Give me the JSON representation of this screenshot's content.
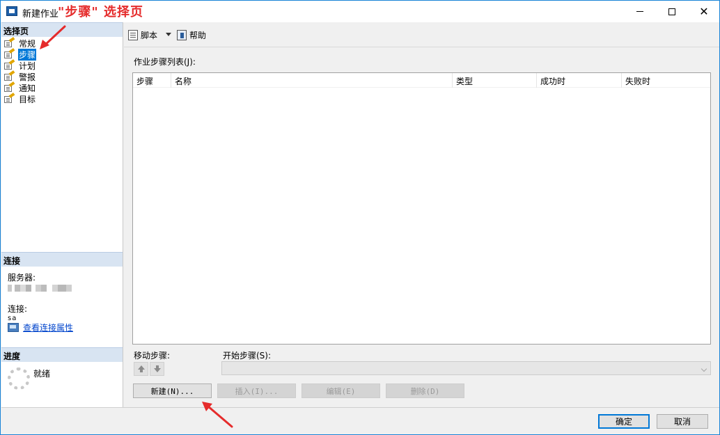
{
  "window": {
    "title": "新建作业",
    "annotation": "\"步骤\" 选择页",
    "minimize_label": "minimize",
    "maximize_label": "maximize",
    "close_glyph": "✕"
  },
  "left_panel": {
    "pages_header": "选择页",
    "pages": [
      {
        "label": "常规",
        "selected": false
      },
      {
        "label": "步骤",
        "selected": true
      },
      {
        "label": "计划",
        "selected": false
      },
      {
        "label": "警报",
        "selected": false
      },
      {
        "label": "通知",
        "selected": false
      },
      {
        "label": "目标",
        "selected": false
      }
    ],
    "connection_header": "连接",
    "server_label": "服务器:",
    "connection_label": "连接:",
    "connection_user": "sa",
    "view_properties_link": "查看连接属性",
    "progress_header": "进度",
    "progress_status": "就绪"
  },
  "toolbar": {
    "script_label": "脚本",
    "help_label": "帮助"
  },
  "steps": {
    "list_label": "作业步骤列表(J):",
    "columns": [
      "步骤",
      "名称",
      "类型",
      "成功时",
      "失败时"
    ],
    "rows": []
  },
  "move": {
    "label": "移动步骤:"
  },
  "start_step": {
    "label": "开始步骤(S):",
    "value": ""
  },
  "actions": {
    "new_label": "新建(N)...",
    "insert_label": "插入(I)...",
    "edit_label": "编辑(E)",
    "delete_label": "删除(D)"
  },
  "dialog": {
    "ok_label": "确定",
    "cancel_label": "取消"
  },
  "colors": {
    "accent": "#0078d7",
    "annotation_red": "#e52b2b",
    "section_header_bg": "#d8e4f2"
  },
  "icons": {
    "page_item": "page-edit-icon",
    "script": "script-icon",
    "help": "help-icon",
    "view_properties": "properties-icon",
    "progress": "spinner-icon"
  }
}
